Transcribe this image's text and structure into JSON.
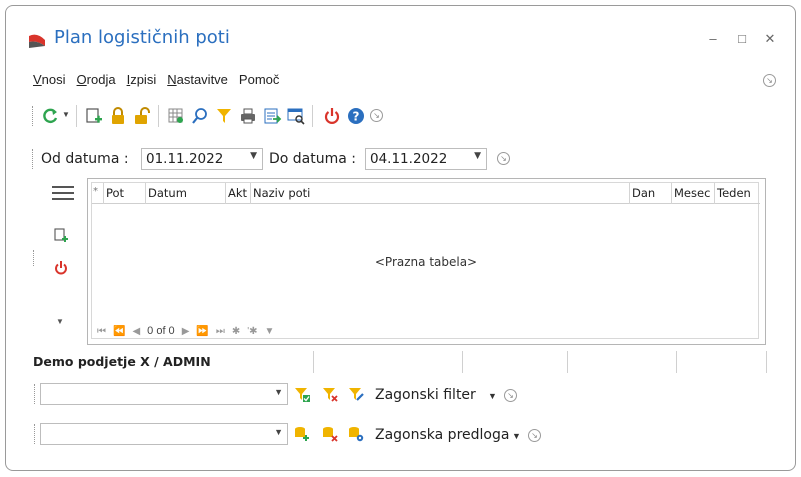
{
  "window": {
    "title": "Plan logističnih poti",
    "minimize": "–",
    "maximize": "□",
    "close": "✕"
  },
  "menu": {
    "items": [
      {
        "label": "Vnosi",
        "key": "V"
      },
      {
        "label": "Orodja",
        "key": "O"
      },
      {
        "label": "Izpisi",
        "key": "I"
      },
      {
        "label": "Nastavitve",
        "key": "N"
      },
      {
        "label": "Pomoč",
        "key": ""
      }
    ]
  },
  "toolbar": {
    "icons": [
      "refresh-icon",
      "dropdown-arrow-icon",
      "new-document-icon",
      "lock-icon",
      "unlock-icon",
      "grid-settings-icon",
      "search-icon",
      "filter-icon",
      "print-icon",
      "export-icon",
      "table-search-icon",
      "power-icon",
      "help-icon"
    ]
  },
  "dates": {
    "from_label": "Od datuma :",
    "from_value": "01.11.2022",
    "to_label": "Do datuma :",
    "to_value": "04.11.2022"
  },
  "grid": {
    "columns": [
      "*",
      "Pot",
      "Datum",
      "Akt",
      "Naziv poti",
      "Dan",
      "Mesec",
      "Teden"
    ],
    "empty_text": "<Prazna tabela>",
    "pager": "0 of 0"
  },
  "status": {
    "company_user": "Demo podjetje X / ADMIN"
  },
  "filter": {
    "label": "Zagonski filter",
    "value": ""
  },
  "template": {
    "label": "Zagonska predloga",
    "value": ""
  },
  "colors": {
    "title": "#2b6fbf",
    "refresh": "#2ea44f",
    "lock": "#e0a400",
    "filter": "#f0b400",
    "power": "#d9342b",
    "help": "#2b6fbf"
  }
}
